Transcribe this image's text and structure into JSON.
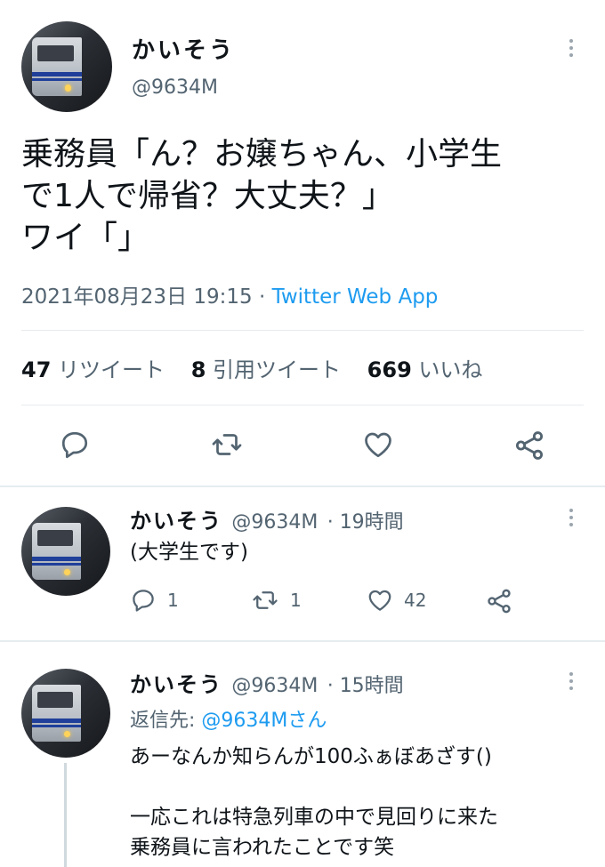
{
  "main_tweet": {
    "display_name": "かいそう",
    "handle": "@9634M",
    "text": "乗務員「ん？お嬢ちゃん、小学生\nで1人で帰省？大丈夫？」\nワイ「」",
    "timestamp": "2021年08月23日 19:15",
    "separator": "·",
    "source": "Twitter Web App",
    "stats": {
      "retweets": "47",
      "retweets_label": "リツイート",
      "quotes": "8",
      "quotes_label": "引用ツイート",
      "likes": "669",
      "likes_label": "いいね"
    },
    "actions": [
      "reply-icon",
      "retweet-icon",
      "like-icon",
      "share-icon"
    ]
  },
  "replies": [
    {
      "display_name": "かいそう",
      "handle": "@9634M",
      "time": "· 19時間",
      "text": "(大学生です)",
      "reply_count": "1",
      "retweet_count": "1",
      "like_count": "42"
    },
    {
      "display_name": "かいそう",
      "handle": "@9634M",
      "time": "· 15時間",
      "replying_label": "返信先: ",
      "replying_to": "@9634Mさん",
      "text": "あーなんか知らんが100ふぁぼあざす()\n\n一応これは特急列車の中で見回りに来た\n乗務員に言われたことです笑"
    }
  ],
  "colors": {
    "accent": "#1d9bf0",
    "muted": "#536471",
    "text": "#0f1419",
    "divider": "#e6ecf0"
  }
}
